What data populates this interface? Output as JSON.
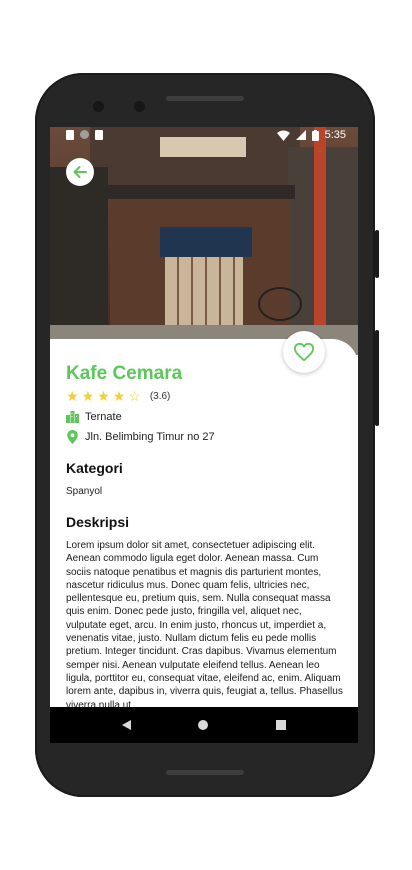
{
  "status_bar": {
    "time": "5:35"
  },
  "place": {
    "name": "Kafe Cemara",
    "rating_count": "(3.6)",
    "stars_filled": 4,
    "stars_total": 5,
    "city": "Ternate",
    "address": "Jln. Belimbing Timur no 27"
  },
  "sections": {
    "category_title": "Kategori",
    "category_value": "Spanyol",
    "description_title": "Deskripsi",
    "description_text": "Lorem ipsum dolor sit amet, consectetuer adipiscing elit. Aenean commodo ligula eget dolor. Aenean massa. Cum sociis natoque penatibus et magnis dis parturient montes, nascetur ridiculus mus. Donec quam felis, ultricies nec, pellentesque eu, pretium quis, sem. Nulla consequat massa quis enim. Donec pede justo, fringilla vel, aliquet nec, vulputate eget, arcu. In enim justo, rhoncus ut, imperdiet a, venenatis vitae, justo. Nullam dictum felis eu pede mollis pretium. Integer tincidunt. Cras dapibus. Vivamus elementum semper nisi. Aenean vulputate eleifend tellus. Aenean leo ligula, porttitor eu, consequat vitae, eleifend ac, enim. Aliquam lorem ante, dapibus in, viverra quis, feugiat a, tellus. Phasellus viverra nulla ut"
  },
  "icons": {
    "back": "arrow-left-icon",
    "favorite": "heart-outline-icon",
    "city": "city-buildings-icon",
    "address": "map-pin-icon"
  },
  "colors": {
    "accent": "#5cc85a",
    "star": "#f6cf2f"
  }
}
